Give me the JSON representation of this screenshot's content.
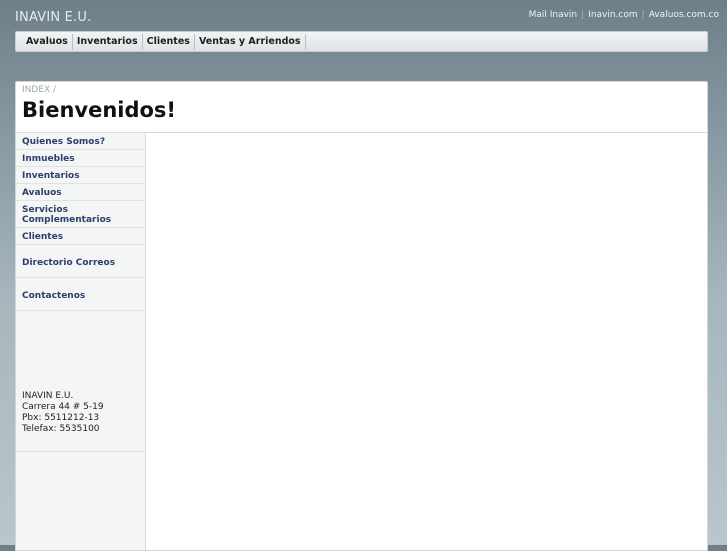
{
  "header": {
    "site_title": "INAVIN E.U.",
    "links": [
      "Mail Inavin",
      "Inavin.com",
      "Avaluos.com.co"
    ]
  },
  "nav": {
    "items": [
      "Avaluos",
      "Inventarios",
      "Clientes",
      "Ventas y Arriendos"
    ]
  },
  "breadcrumb": "INDEX /",
  "page_title": "Bienvenidos!",
  "sidebar": {
    "items": [
      "Quienes Somos?",
      "Inmuebles",
      "Inventarios",
      "Avaluos",
      "Servicios Complementarios",
      "Clientes",
      "Directorio Correos",
      "Contactenos"
    ],
    "address": {
      "line1": "INAVIN E.U.",
      "line2": "Carrera 44 # 5-19",
      "line3": "Pbx: 5511212-13",
      "line4": "Telefax: 5535100"
    }
  }
}
